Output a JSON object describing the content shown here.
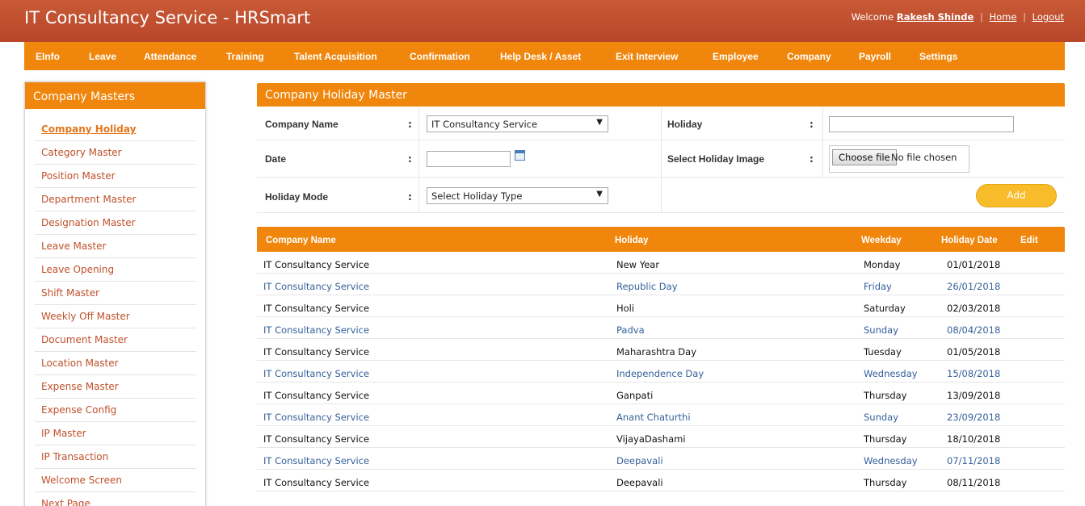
{
  "header": {
    "title": "IT Consultancy Service - HRSmart",
    "welcome_prefix": "Welcome",
    "user_name": "Rakesh Shinde",
    "home_link": "Home",
    "logout_link": "Logout",
    "separator": "|"
  },
  "menu": {
    "items": [
      "EInfo",
      "Leave",
      "Attendance",
      "Training",
      "Talent Acquisition",
      "Confirmation",
      "Help Desk / Asset",
      "Exit Interview",
      "Employee",
      "Company",
      "Payroll",
      "Settings"
    ]
  },
  "sidebar": {
    "title": "Company Masters",
    "active": "Company Holiday",
    "items": [
      "Company Holiday",
      "Category Master",
      "Position Master",
      "Department Master",
      "Designation Master",
      "Leave Master",
      "Leave Opening",
      "Shift Master",
      "Weekly Off Master",
      "Document Master",
      "Location Master",
      "Expense Master",
      "Expense Config",
      "IP Master",
      "IP Transaction",
      "Welcome Screen",
      "Next Page"
    ]
  },
  "form": {
    "title": "Company Holiday Master",
    "colon": ":",
    "company_name_label": "Company Name",
    "company_name_value": "IT Consultancy Service",
    "holiday_label": "Holiday",
    "holiday_value": "",
    "date_label": "Date",
    "date_value": "",
    "image_label": "Select Holiday Image",
    "choose_file_label": "Choose file",
    "no_file_text": "No file chosen",
    "holiday_mode_label": "Holiday Mode",
    "holiday_mode_value": "Select Holiday Type",
    "dropdown_arrow": "▼",
    "add_button": "Add"
  },
  "colors": {
    "accent": "#f0860c",
    "header": "#b8462a",
    "sidebar_link": "#c0502a",
    "alt_row_text": "#34609a",
    "add_button": "#f8bc2a"
  },
  "table": {
    "columns": {
      "company": "Company Name",
      "holiday": "Holiday",
      "weekday": "Weekday",
      "date": "Holiday Date",
      "edit": "Edit"
    },
    "rows": [
      {
        "company": "IT Consultancy Service",
        "holiday": "New Year",
        "weekday": "Monday",
        "date": "01/01/2018"
      },
      {
        "company": "IT Consultancy Service",
        "holiday": "Republic Day",
        "weekday": "Friday",
        "date": "26/01/2018"
      },
      {
        "company": "IT Consultancy Service",
        "holiday": "Holi",
        "weekday": "Saturday",
        "date": "02/03/2018"
      },
      {
        "company": "IT Consultancy Service",
        "holiday": "Padva",
        "weekday": "Sunday",
        "date": "08/04/2018"
      },
      {
        "company": "IT Consultancy Service",
        "holiday": "Maharashtra Day",
        "weekday": "Tuesday",
        "date": "01/05/2018"
      },
      {
        "company": "IT Consultancy Service",
        "holiday": "Independence Day",
        "weekday": "Wednesday",
        "date": "15/08/2018"
      },
      {
        "company": "IT Consultancy Service",
        "holiday": "Ganpati",
        "weekday": "Thursday",
        "date": "13/09/2018"
      },
      {
        "company": "IT Consultancy Service",
        "holiday": "Anant Chaturthi",
        "weekday": "Sunday",
        "date": "23/09/2018"
      },
      {
        "company": "IT Consultancy Service",
        "holiday": "VijayaDashami",
        "weekday": "Thursday",
        "date": "18/10/2018"
      },
      {
        "company": "IT Consultancy Service",
        "holiday": "Deepavali",
        "weekday": "Wednesday",
        "date": "07/11/2018"
      },
      {
        "company": "IT Consultancy Service",
        "holiday": "Deepavali",
        "weekday": "Thursday",
        "date": "08/11/2018"
      }
    ]
  }
}
